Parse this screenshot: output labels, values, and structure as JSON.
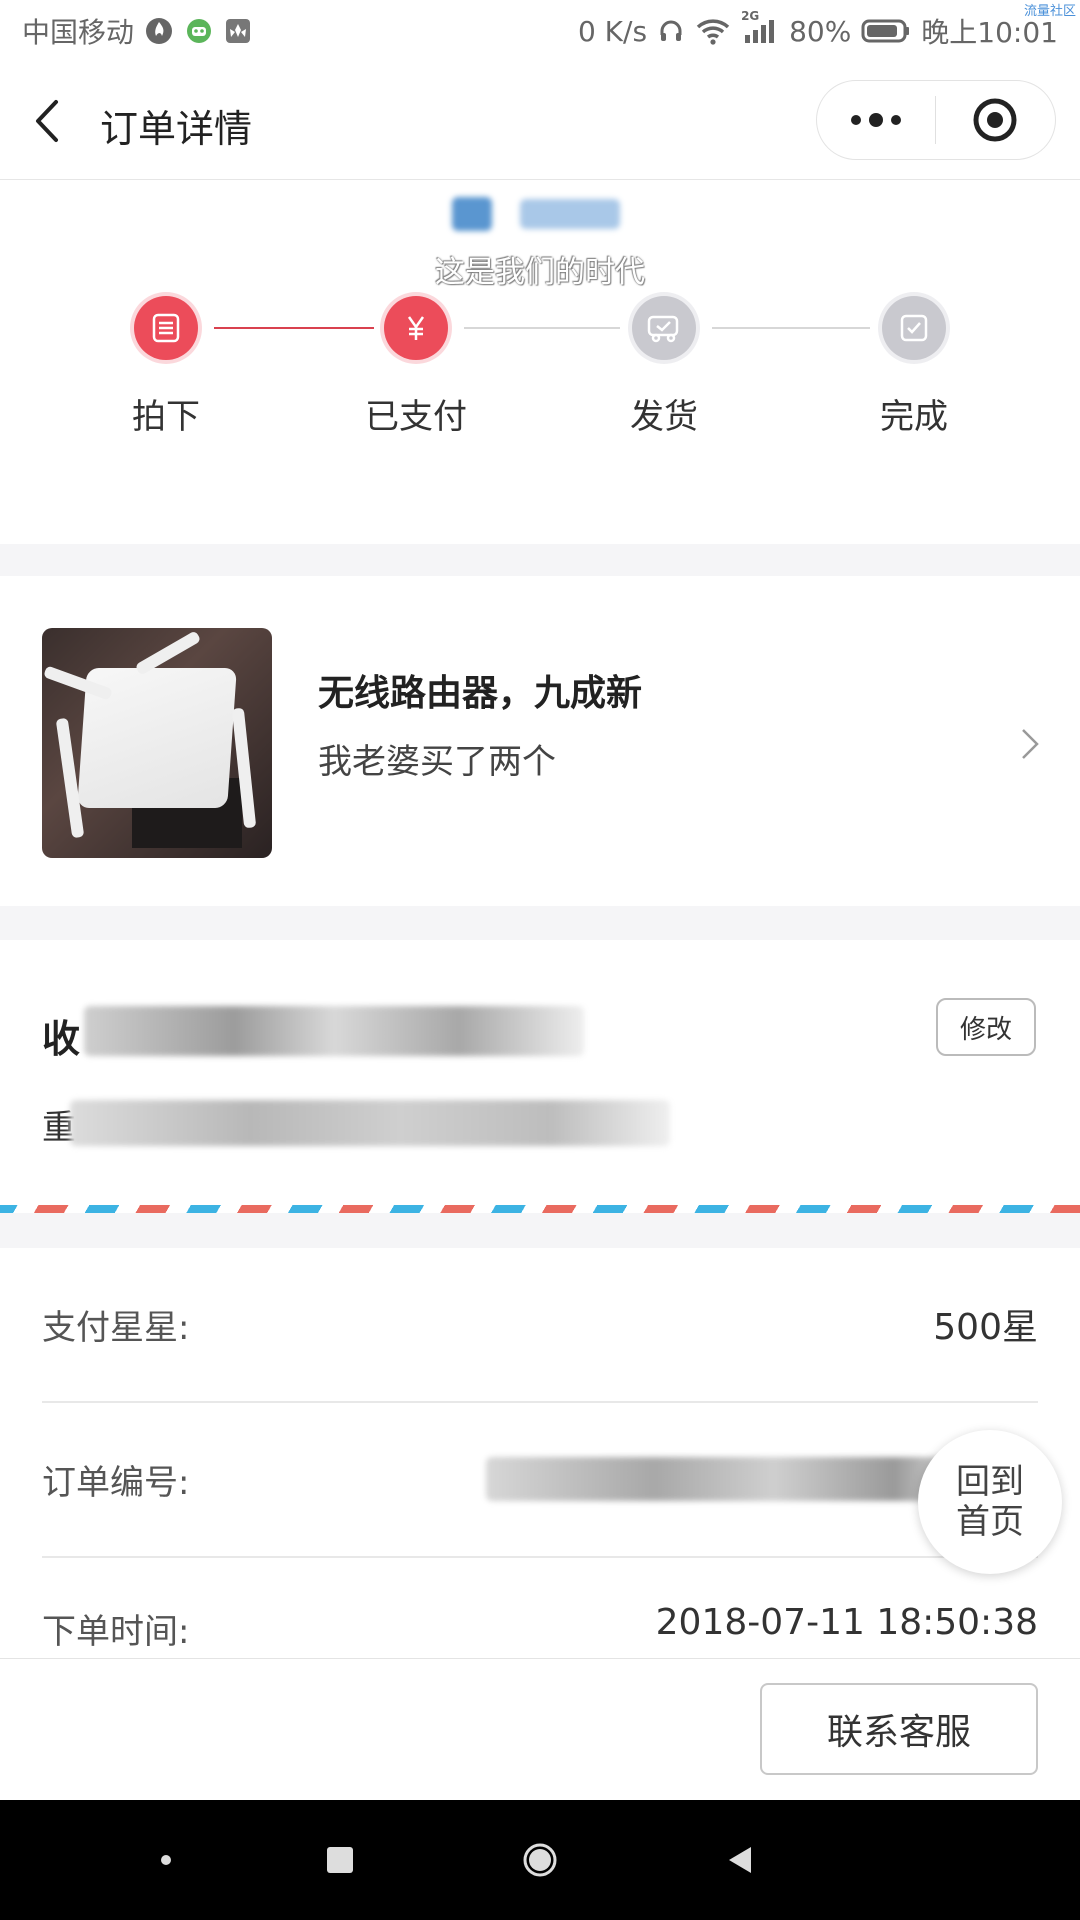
{
  "status_bar": {
    "carrier": "中国移动",
    "network_speed": "0 K/s",
    "network_type": "2G",
    "battery": "80%",
    "time": "晚上10:01",
    "watermark": "流量社区"
  },
  "header": {
    "title": "订单详情"
  },
  "progress": {
    "slogan": "这是我们的时代",
    "steps": [
      {
        "label": "拍下",
        "state": "active",
        "icon": "list-icon"
      },
      {
        "label": "已支付",
        "state": "active",
        "icon": "yen-icon"
      },
      {
        "label": "发货",
        "state": "inactive",
        "icon": "truck-icon"
      },
      {
        "label": "完成",
        "state": "inactive",
        "icon": "check-icon"
      }
    ]
  },
  "product": {
    "title": "无线路由器，九成新",
    "description": "我老婆买了两个"
  },
  "address": {
    "recipient_prefix": "收",
    "address_prefix": "重",
    "edit_label": "修改"
  },
  "info": {
    "payment_label": "支付星星:",
    "payment_value": "500星",
    "order_no_label": "订单编号:",
    "order_time_label": "下单时间:",
    "order_time_value": "2018-07-11 18:50:38"
  },
  "home_button": {
    "line1": "回到",
    "line2": "首页"
  },
  "actions": {
    "contact_service": "联系客服"
  },
  "colors": {
    "accent": "#ec4c5a",
    "inactive": "#c9c9cf",
    "airmail_red": "#e96a5f",
    "airmail_blue": "#3cb3e3"
  }
}
